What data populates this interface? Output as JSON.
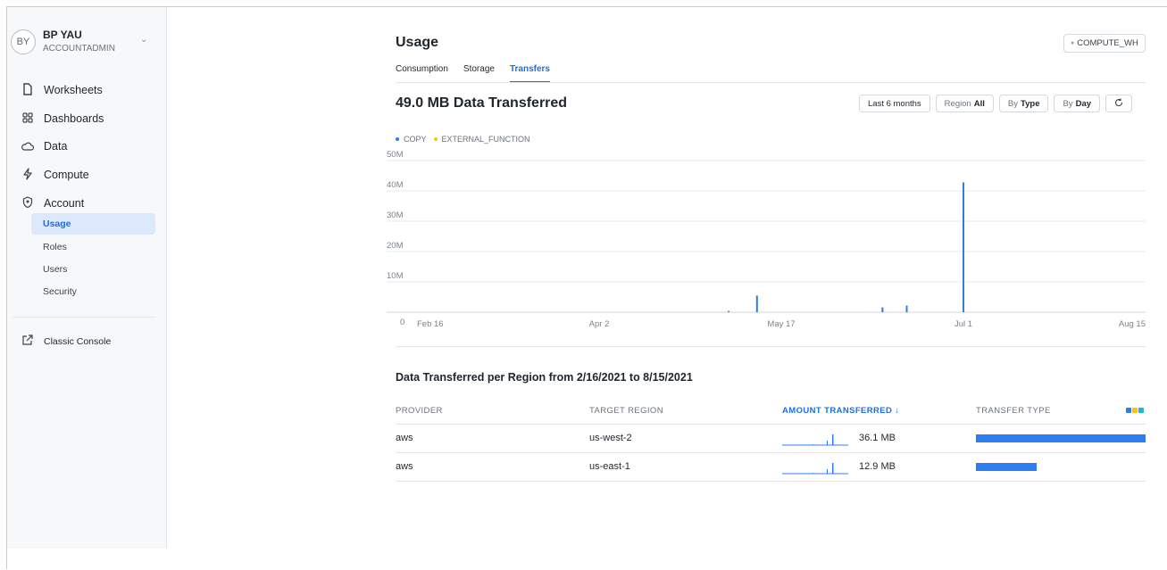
{
  "user": {
    "initials": "BY",
    "name": "BP YAU",
    "role": "ACCOUNTADMIN"
  },
  "nav": {
    "items": [
      {
        "label": "Worksheets",
        "icon": "file-icon"
      },
      {
        "label": "Dashboards",
        "icon": "grid-icon"
      },
      {
        "label": "Data",
        "icon": "cloud-icon"
      },
      {
        "label": "Compute",
        "icon": "lightning-icon"
      },
      {
        "label": "Account",
        "icon": "shield-icon"
      }
    ],
    "sub_items": [
      {
        "label": "Usage",
        "active": true
      },
      {
        "label": "Roles",
        "active": false
      },
      {
        "label": "Users",
        "active": false
      },
      {
        "label": "Security",
        "active": false
      }
    ],
    "classic_console": "Classic Console"
  },
  "page": {
    "title": "Usage",
    "warehouse": "COMPUTE_WH",
    "tabs": [
      "Consumption",
      "Storage",
      "Transfers"
    ],
    "active_tab": "Transfers"
  },
  "summary": {
    "heading": "49.0 MB Data Transferred",
    "range_btn": "Last 6 months",
    "region_label": "Region",
    "region_value": "All",
    "by_label_1": "By",
    "by_value_1": "Type",
    "by_label_2": "By",
    "by_value_2": "Day",
    "refresh_icon": "refresh-icon"
  },
  "chart_data": {
    "type": "bar",
    "series": [
      {
        "name": "COPY",
        "color": "#2d7cf0"
      },
      {
        "name": "EXTERNAL_FUNCTION",
        "color": "#f5c518"
      }
    ],
    "y_ticks": [
      "50M",
      "40M",
      "30M",
      "20M",
      "10M",
      "0"
    ],
    "ylim": [
      0,
      50
    ],
    "x_ticks": [
      "Feb 16",
      "Apr 2",
      "May 17",
      "Jul 1",
      "Aug 15"
    ],
    "x_range": [
      "2021-02-16",
      "2021-08-15"
    ],
    "bars": [
      {
        "date": "2021-05-04",
        "value": 0.4
      },
      {
        "date": "2021-05-11",
        "value": 5.5
      },
      {
        "date": "2021-06-11",
        "value": 1.6
      },
      {
        "date": "2021-06-17",
        "value": 2.2
      },
      {
        "date": "2021-07-01",
        "value": 42.8
      }
    ]
  },
  "region_table": {
    "title": "Data Transferred per Region from 2/16/2021 to 8/15/2021",
    "headers": [
      "PROVIDER",
      "TARGET REGION",
      "AMOUNT TRANSFERRED",
      "TRANSFER TYPE"
    ],
    "sort_icon": "arrow-down-icon",
    "type_colors": [
      "#2d7cf0",
      "#f5c518",
      "#22b8c9"
    ],
    "rows": [
      {
        "provider": "aws",
        "region": "us-west-2",
        "amount": "36.1 MB",
        "share": 1.0
      },
      {
        "provider": "aws",
        "region": "us-east-1",
        "amount": "12.9 MB",
        "share": 0.36
      }
    ]
  }
}
